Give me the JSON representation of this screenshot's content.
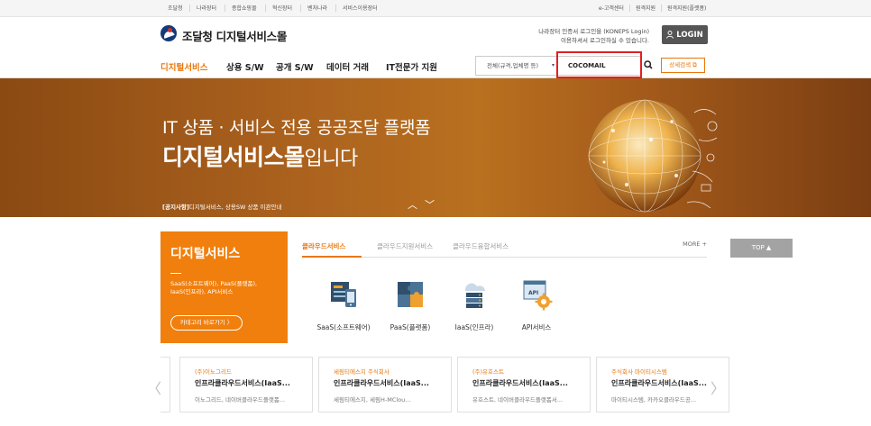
{
  "topbar": {
    "left_links": [
      "조달청",
      "나라장터",
      "종합쇼핑몰",
      "혁신장터",
      "벤처나라",
      "서비스이용장터"
    ],
    "right_links": [
      "e-고객센터",
      "원격지원",
      "원격지원(플랫폼)"
    ]
  },
  "header": {
    "logo_text": "조달청 디지털서비스몰",
    "login_msg_line1": "나라장터 인증서 로그인을 (KONEPS Login)",
    "login_msg_line2": "이용하셔서 로그인하실 수 있습니다.",
    "login_label": "LOGIN"
  },
  "nav": {
    "items": [
      "디지털서비스",
      "상용 S/W",
      "공개 S/W",
      "데이터 거래",
      "IT전문가 지원"
    ],
    "active_index": 0
  },
  "search": {
    "select_value": "전체(규격,업체명 등)",
    "input_value": "COCOMAIL",
    "detail_label": "상세검색"
  },
  "banner": {
    "line1": "IT 상품 · 서비스 전용 공공조달 플랫폼",
    "line2_bold": "디지털서비스몰",
    "line2_rest": "입니다",
    "notice_tag": "[공지사항]",
    "notice_text": "디지털서비스, 상용SW 상품 이관안내"
  },
  "category": {
    "title": "디지털서비스",
    "desc_line1": "SaaS(소프트웨어), PaaS(플랫폼),",
    "desc_line2": "IaaS(인프라), API서비스",
    "link_label": "카테고리 바로가기 〉"
  },
  "tabs": {
    "items": [
      "클라우드서비스",
      "클라우드지원서비스",
      "클라우드융합서비스"
    ],
    "more_label": "MORE +"
  },
  "services": [
    {
      "label": "SaaS(소프트웨어)",
      "icon": "saas-icon"
    },
    {
      "label": "PaaS(플랫폼)",
      "icon": "paas-icon"
    },
    {
      "label": "IaaS(인프라)",
      "icon": "iaas-icon"
    },
    {
      "label": "API서비스",
      "icon": "api-icon"
    }
  ],
  "top_button": "TOP ▲",
  "cards": [
    {
      "company": "(주)이노그리드",
      "title": "인프라클라우드서비스(IaaS...",
      "desc": "이노그리드, 네이버클라우드플랫폼..."
    },
    {
      "company": "세림티에스지 주식회사",
      "title": "인프라클라우드서비스(IaaS...",
      "desc": "세림티에스지, 세림H-MClou..."
    },
    {
      "company": "(주)유호스트",
      "title": "인프라클라우드서비스(IaaS...",
      "desc": "유호스트, 네이버클라우드플랫폼서..."
    },
    {
      "company": "주식회사 마이티시스템",
      "title": "인프라클라우드서비스(IaaS...",
      "desc": "마이티시스템, 카카오클라우드공..."
    }
  ],
  "colors": {
    "accent": "#e8760a",
    "category_bg": "#f07f0d",
    "banner": "#a85f1d",
    "highlight": "#e02020"
  }
}
